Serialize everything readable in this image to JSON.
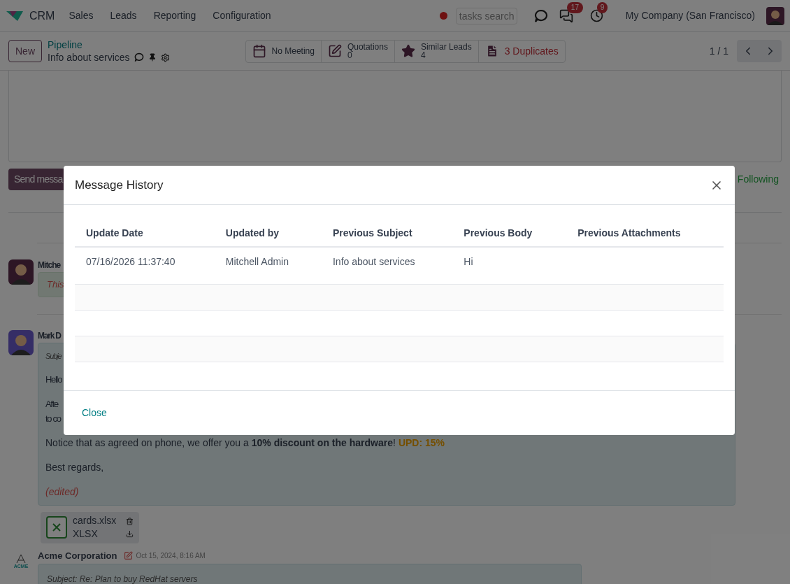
{
  "top_nav": {
    "app": "CRM",
    "menu": [
      "Sales",
      "Leads",
      "Reporting",
      "Configuration"
    ],
    "search": {
      "placeholder": "tasks search"
    },
    "messages_badge": "17",
    "activities_badge": "9",
    "company": "My Company (San Francisco)"
  },
  "control_bar": {
    "new_button": "New",
    "breadcrumb": "Pipeline",
    "record_title": "Info about services",
    "pager": "1 / 1",
    "smart_buttons": [
      {
        "kind": "calendar",
        "label": "No Meeting",
        "alert": false
      },
      {
        "kind": "edit",
        "label": "Quotations",
        "count": "0",
        "alert": false
      },
      {
        "kind": "star",
        "label": "Similar Leads",
        "count": "4",
        "alert": false
      },
      {
        "kind": "document",
        "label": "3 Duplicates",
        "alert": true
      }
    ]
  },
  "chatter": {
    "send_button": "Send messa",
    "follow_label": "Following",
    "log_note": {
      "author": "Mitche",
      "text": "This"
    },
    "email": {
      "author": "Mark D",
      "subject": "Subje",
      "paragraphs": [
        [
          "Hello"
        ],
        [
          "Afte",
          "to co"
        ]
      ],
      "notice": "Notice that as agreed on phone, we offer you a **10% discount on the hardware**!",
      "update": "UPD: 15%",
      "closing": "Best regards,",
      "edited": "(edited)",
      "attachment": {
        "name": "cards.xlsx",
        "type": "XLSX"
      }
    },
    "next_message": {
      "author": "Acme Corporation",
      "logo_text": "ACME",
      "date": "Oct 15, 2024, 8:16 AM",
      "subject": "Subject: Re: Plan to buy RedHat servers"
    }
  },
  "modal": {
    "title": "Message History",
    "columns": [
      "Update Date",
      "Updated by",
      "Previous Subject",
      "Previous Body",
      "Previous Attachments"
    ],
    "rows": [
      [
        "07/16/2026 11:37:40",
        "Mitchell Admin",
        "Info about services",
        "Hi",
        ""
      ]
    ],
    "close_button": "Close"
  }
}
